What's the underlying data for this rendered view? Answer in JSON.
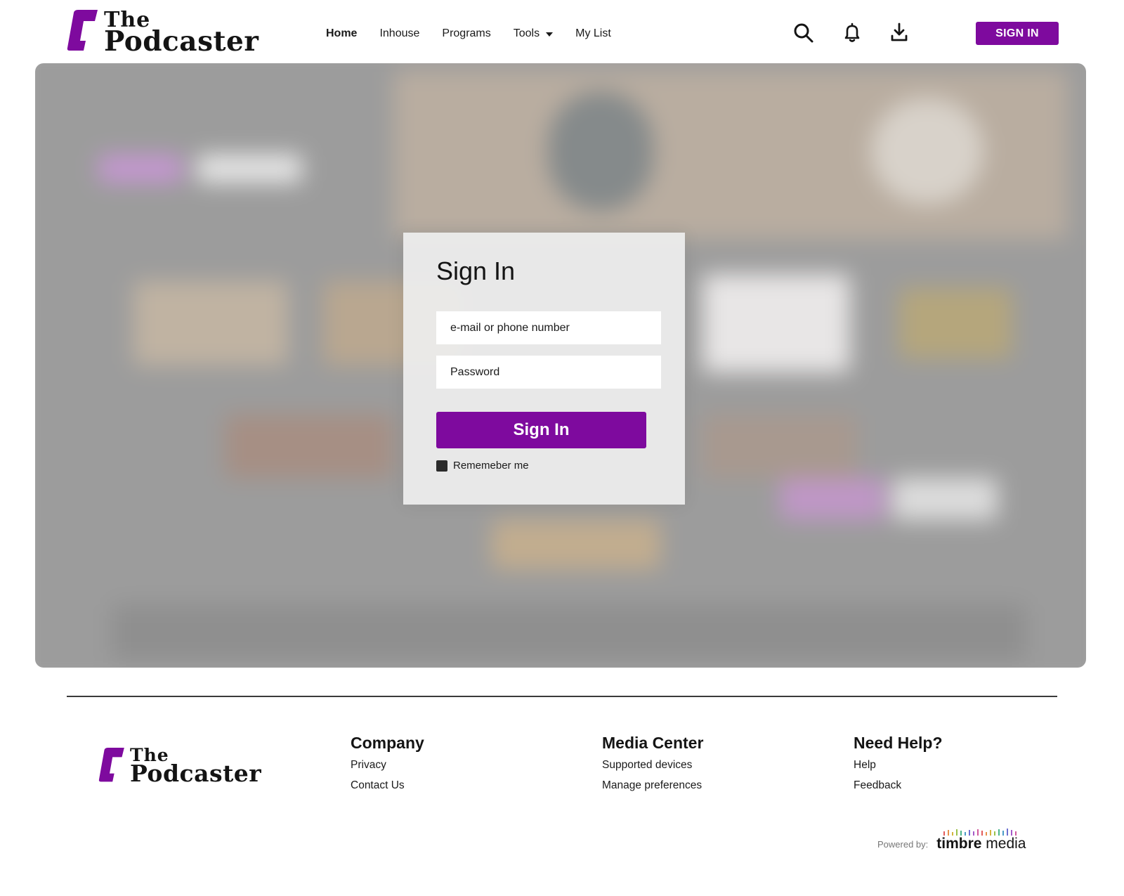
{
  "brand": {
    "logo_line1": "The",
    "logo_line2": "Podcaster",
    "accent_color": "#7e0a9e"
  },
  "header": {
    "nav": [
      {
        "label": "Home",
        "active": true
      },
      {
        "label": "Inhouse"
      },
      {
        "label": "Programs"
      },
      {
        "label": "Tools",
        "has_dropdown": true
      },
      {
        "label": "My List"
      }
    ],
    "icons": [
      "search-icon",
      "bell-icon",
      "download-icon"
    ],
    "signin_label": "SIGN IN"
  },
  "modal": {
    "title": "Sign In",
    "email_placeholder": "e-mail or phone number",
    "password_placeholder": "Password",
    "submit_label": "Sign In",
    "remember_label": "Rememeber me"
  },
  "footer": {
    "columns": [
      {
        "heading": "Company",
        "links": [
          "Privacy",
          "Contact Us"
        ]
      },
      {
        "heading": "Media Center",
        "links": [
          "Supported devices",
          "Manage preferences"
        ]
      },
      {
        "heading": "Need Help?",
        "links": [
          "Help",
          "Feedback"
        ]
      }
    ],
    "powered_by_label": "Powered by:",
    "powered_by_brand_bold": "timbre",
    "powered_by_brand_rest": " media"
  }
}
